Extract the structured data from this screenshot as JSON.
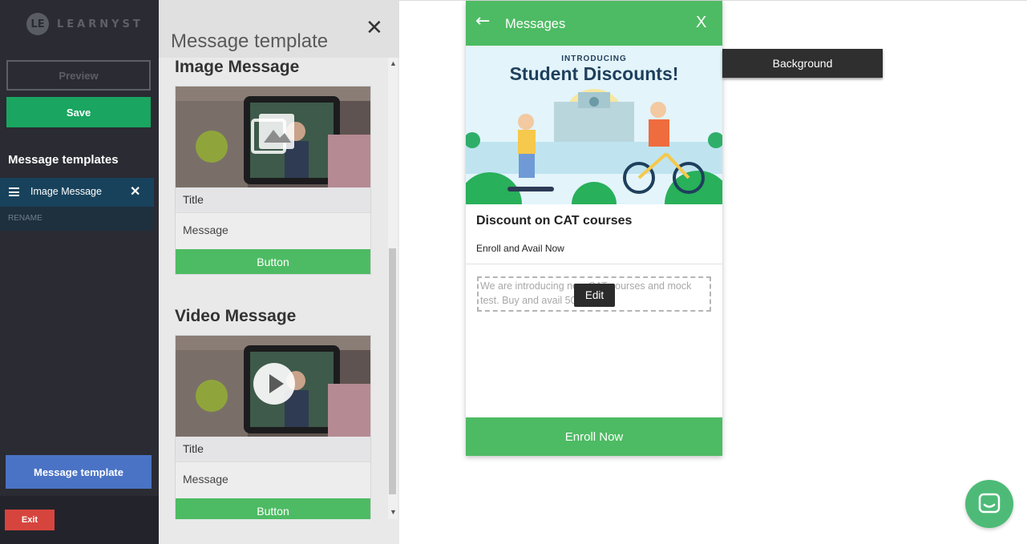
{
  "brand": {
    "mark": "LE",
    "name": "LEARNYST"
  },
  "sidebar": {
    "preview_label": "Preview",
    "save_label": "Save",
    "heading": "Message templates",
    "items": [
      {
        "label": "Image Message"
      }
    ],
    "rename_label": "RENAME",
    "message_template_label": "Message template",
    "exit_label": "Exit"
  },
  "panel": {
    "title": "Message template",
    "sections": [
      {
        "title": "Image Message",
        "card_title": "Title",
        "card_message": "Message",
        "card_button": "Button",
        "overlay_icon": "image-icon"
      },
      {
        "title": "Video Message",
        "card_title": "Title",
        "card_message": "Message",
        "card_button": "Button",
        "overlay_icon": "play-icon"
      }
    ]
  },
  "phone": {
    "header_title": "Messages",
    "close_label": "X",
    "banner_kicker": "INTRODUCING",
    "banner_headline": "Student Discounts!",
    "message_title": "Discount on CAT courses",
    "message_subtitle": "Enroll and Avail Now",
    "message_body": "We are introducing new CAT courses and mock test. Buy and avail 50",
    "edit_label": "Edit",
    "cta_label": "Enroll Now"
  },
  "background_tooltip": "Background",
  "colors": {
    "green": "#4dbb63",
    "save_green": "#1aa560",
    "blue": "#4a73c5",
    "exit_red": "#d6453d",
    "sidebar_bg": "#2a2b33"
  }
}
